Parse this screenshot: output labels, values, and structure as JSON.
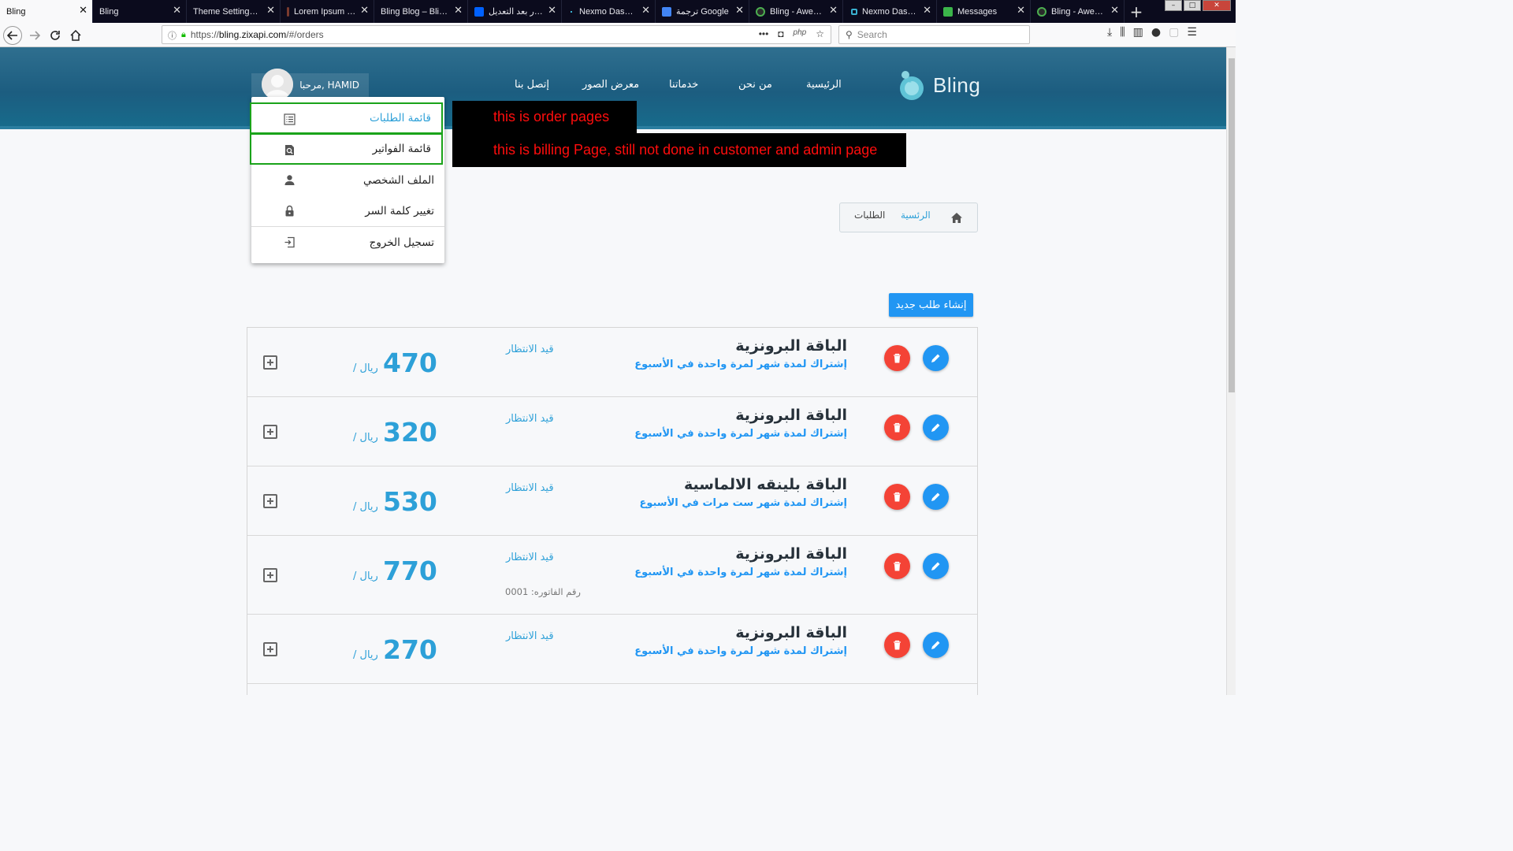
{
  "browser": {
    "tabs": [
      {
        "title": "Bling",
        "active": true,
        "favicon_color": "#f9f9fa"
      },
      {
        "title": "Bling",
        "active": false,
        "favicon_color": "#0b0b1d"
      },
      {
        "title": "Theme Settings ‹ Al",
        "active": false,
        "favicon_color": "#0b0b1d"
      },
      {
        "title": "Lorem Ipsum - A",
        "active": false,
        "favicon_color": "#7a3b2e"
      },
      {
        "title": "Bling Blog – Bling S",
        "active": false,
        "favicon_color": "#0b0b1d"
      },
      {
        "title": "الصور بعد التعديل",
        "active": false,
        "favicon_color": "#0061fe"
      },
      {
        "title": "Nexmo Dashboa",
        "active": false,
        "favicon_color": "#0b0b1d"
      },
      {
        "title": "ترجمة Google",
        "active": false,
        "favicon_color": "#4285f4"
      },
      {
        "title": "Bling - Awesom",
        "active": false,
        "favicon_color": "#1c1c1c"
      },
      {
        "title": "Nexmo Dashboa",
        "active": false,
        "favicon_color": "#0b0b1d"
      },
      {
        "title": "Messages",
        "active": false,
        "favicon_color": "#3bb54a"
      },
      {
        "title": "Bling - Awesom",
        "active": false,
        "favicon_color": "#1c1c1c"
      }
    ],
    "url_prefix": "https://",
    "url_domain": "bling.zixapi.com",
    "url_path": "/#/orders",
    "url_ellipsis": "•••",
    "url_php": "php",
    "search_placeholder": "Search"
  },
  "site": {
    "logo_text": "Bling",
    "nav": {
      "home": "الرئيسية",
      "about": "من نحن",
      "services": "خدماتنا",
      "gallery": "معرض الصور",
      "contact": "إتصل بنا"
    },
    "user_greeting": "مرحبا, HAMID"
  },
  "user_menu": {
    "items": [
      {
        "label": "قائمة الطلبات",
        "icon": "list-icon"
      },
      {
        "label": "قائمة الفواتير",
        "icon": "invoice-search-icon"
      },
      {
        "label": "الملف الشخصي",
        "icon": "person-icon"
      },
      {
        "label": "تغيير كلمة السر",
        "icon": "lock-icon"
      },
      {
        "label": "تسجيل الخروج",
        "icon": "logout-icon"
      }
    ]
  },
  "annotations": {
    "order_note": "this is order pages",
    "billing_note": "this is billing Page, still not done in customer and admin page",
    "highlight_color": "#1aa31a",
    "note_text_color": "#ff0d0d"
  },
  "breadcrumb": {
    "home": "الرئسية",
    "current": "الطلبات"
  },
  "new_order_button": "إنشاء طلب جديد",
  "orders": [
    {
      "package": "الباقة البرونزية",
      "subscription": "إشتراك لمدة شهر لمرة واحدة في الأسبوع",
      "status": "قيد الانتظار",
      "price": "470",
      "currency": "/ ريال",
      "invoice": ""
    },
    {
      "package": "الباقة البرونزية",
      "subscription": "إشتراك لمدة شهر لمرة واحدة في الأسبوع",
      "status": "قيد الانتظار",
      "price": "320",
      "currency": "/ ريال",
      "invoice": ""
    },
    {
      "package": "الباقة بلينقه الالماسية",
      "subscription": "إشتراك لمدة شهر ست مرات في الأسبوع",
      "status": "قيد الانتظار",
      "price": "530",
      "currency": "/ ريال",
      "invoice": ""
    },
    {
      "package": "الباقة البرونزية",
      "subscription": "إشتراك لمدة شهر لمرة واحدة في الأسبوع",
      "status": "قيد الانتظار",
      "price": "770",
      "currency": "/ ريال",
      "invoice": "رقم الفاتوره: 0001"
    },
    {
      "package": "الباقة البرونزية",
      "subscription": "إشتراك لمدة شهر لمرة واحدة في الأسبوع",
      "status": "قيد الانتظار",
      "price": "270",
      "currency": "/ ريال",
      "invoice": ""
    }
  ],
  "colors": {
    "primary": "#2196f3",
    "accent_text": "#2da0d8",
    "danger": "#f44336",
    "header": "#1c5d80"
  }
}
